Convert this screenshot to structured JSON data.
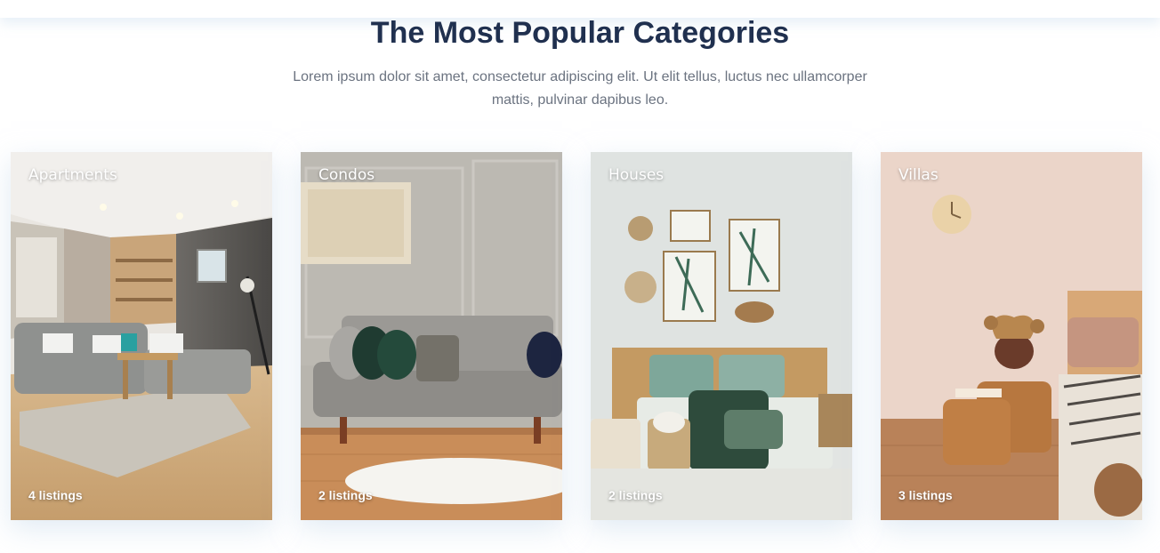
{
  "section": {
    "title": "The Most Popular Categories",
    "subtitle": "Lorem ipsum dolor sit amet, consectetur adipiscing elit. Ut elit tellus, luctus nec ullamcorper mattis, pulvinar dapibus leo."
  },
  "categories": [
    {
      "label": "Apartments",
      "count": "4 listings",
      "icon": "living-room-image"
    },
    {
      "label": "Condos",
      "count": "2 listings",
      "icon": "sofa-room-image"
    },
    {
      "label": "Houses",
      "count": "2 listings",
      "icon": "bedroom-image"
    },
    {
      "label": "Villas",
      "count": "3 listings",
      "icon": "villa-bedroom-image"
    }
  ],
  "colors": {
    "title": "#20304f",
    "subtitle": "#6b7380",
    "card_text": "#ffffff"
  }
}
